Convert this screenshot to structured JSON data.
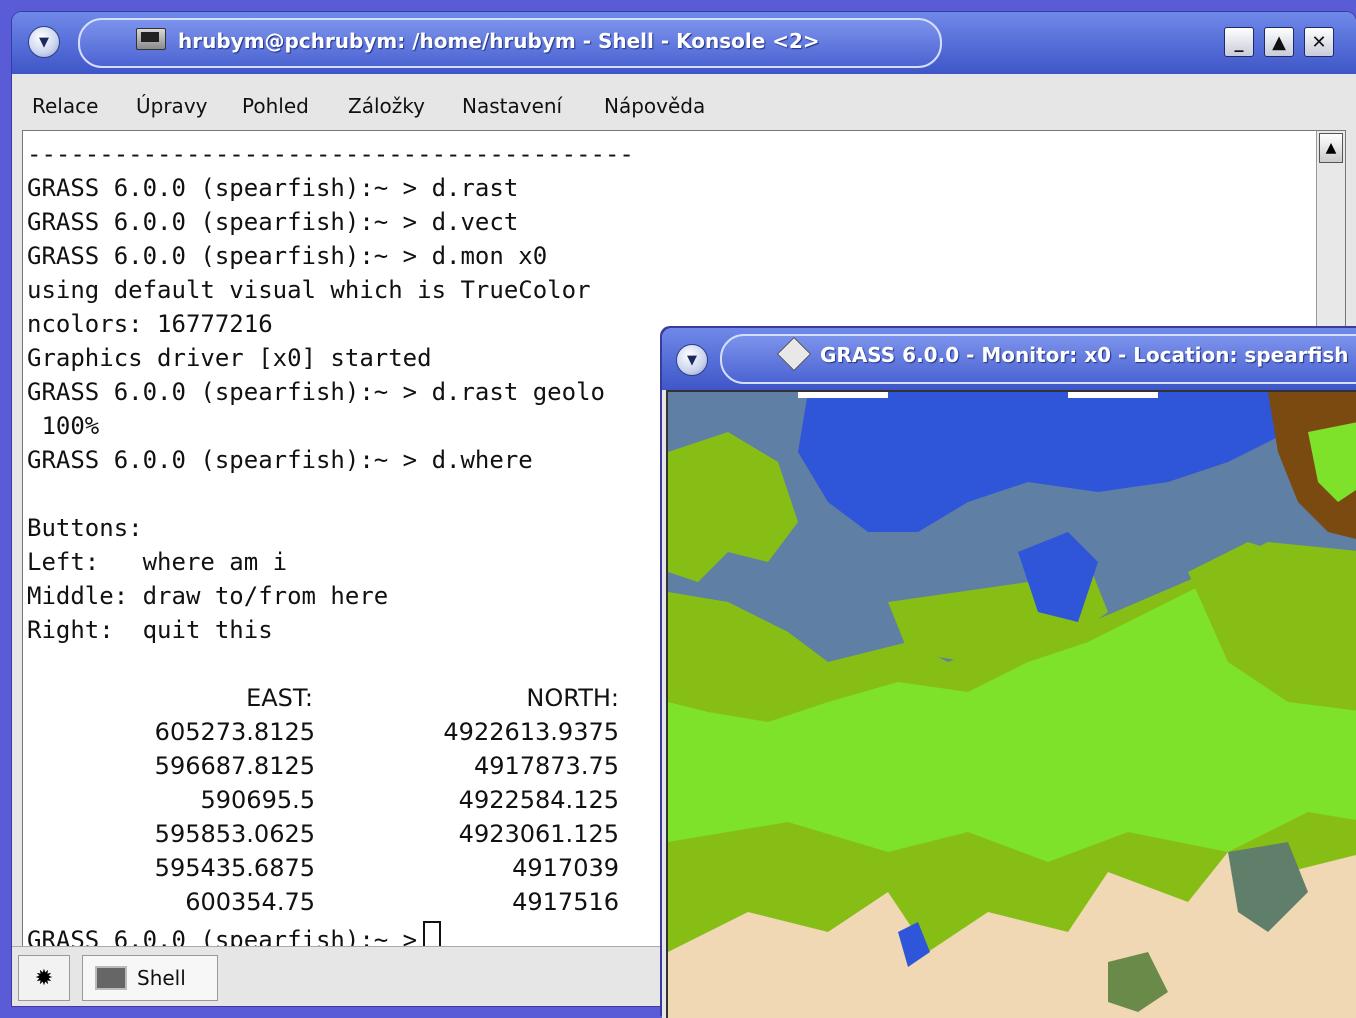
{
  "konsole": {
    "title": "hrubym@pchrubym: /home/hrubym - Shell - Konsole <2>",
    "menu": [
      "Relace",
      "Úpravy",
      "Pohled",
      "Záložky",
      "Nastavení",
      "Nápověda"
    ],
    "lines": [
      "------------------------------------------",
      "GRASS 6.0.0 (spearfish):~ > d.rast",
      "GRASS 6.0.0 (spearfish):~ > d.vect",
      "GRASS 6.0.0 (spearfish):~ > d.mon x0",
      "using default visual which is TrueColor",
      "ncolors: 16777216",
      "Graphics driver [x0] started",
      "GRASS 6.0.0 (spearfish):~ > d.rast geolo",
      " 100%",
      "GRASS 6.0.0 (spearfish):~ > d.where",
      "",
      "Buttons:",
      "Left:   where am i",
      "Middle: draw to/from here",
      "Right:  quit this"
    ],
    "coords_header": {
      "east": "EAST:",
      "north": "NORTH:"
    },
    "coords": [
      {
        "east": "605273.8125",
        "north": "4922613.9375"
      },
      {
        "east": "596687.8125",
        "north": "4917873.75"
      },
      {
        "east": "590695.5",
        "north": "4922584.125"
      },
      {
        "east": "595853.0625",
        "north": "4923061.125"
      },
      {
        "east": "595435.6875",
        "north": "4917039"
      },
      {
        "east": "600354.75",
        "north": "4917516"
      }
    ],
    "prompt": "GRASS 6.0.0 (spearfish):~ >",
    "taskbar_tab": "Shell"
  },
  "monitor": {
    "title": "GRASS 6.0.0 - Monitor: x0 - Location: spearfish"
  },
  "colors": {
    "desktop": "#5a5bd6",
    "titlebar": "#4c64d2",
    "map_water": "#2f55d8",
    "map_slate": "#5f7fa4",
    "map_olive": "#86be16",
    "map_green": "#7ee22a",
    "map_sand": "#f0d8b4",
    "map_brown": "#7a4a10"
  }
}
